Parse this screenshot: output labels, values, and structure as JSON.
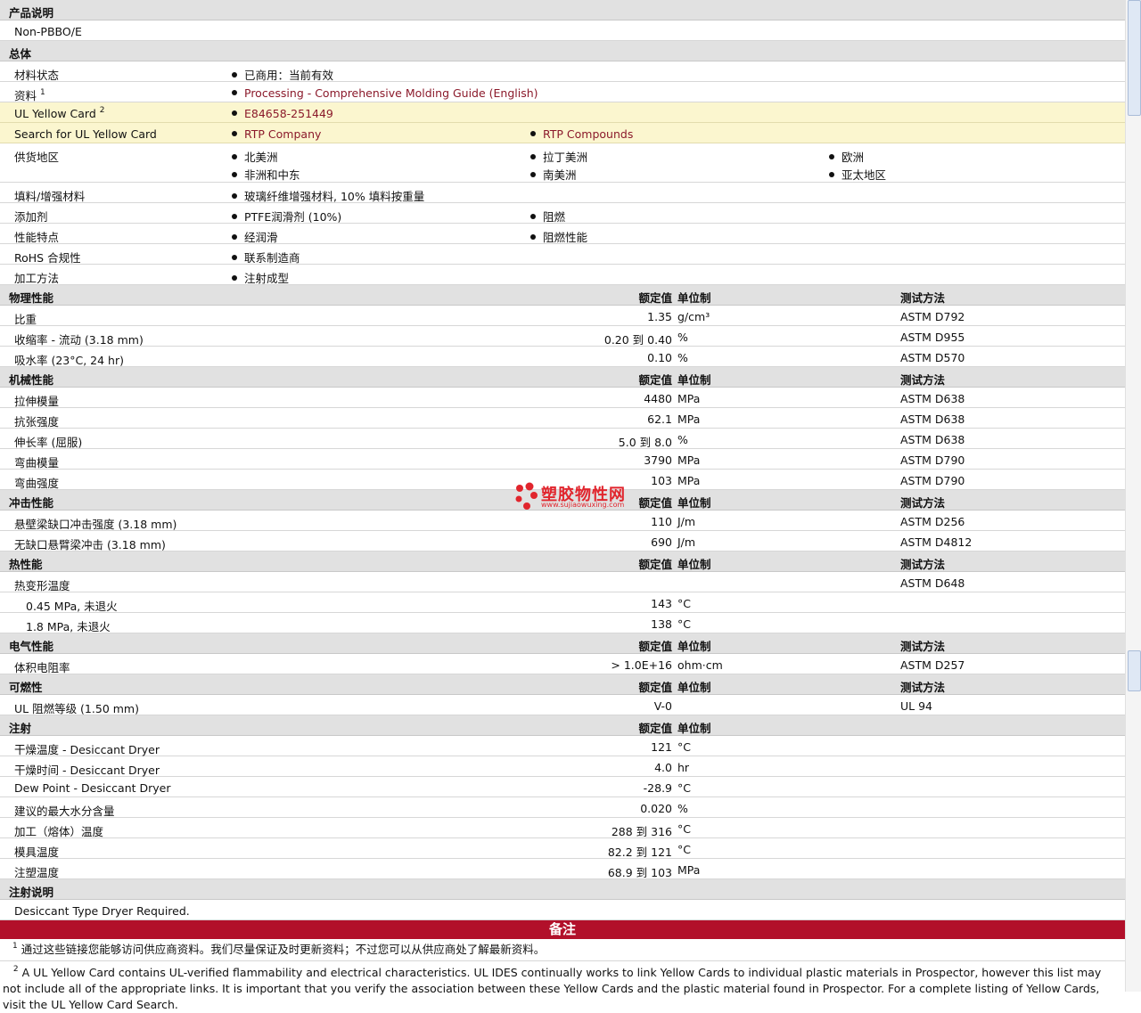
{
  "product_desc": {
    "title": "产品说明",
    "text": "Non-PBBO/E"
  },
  "general": {
    "title": "总体",
    "material_status": {
      "label": "材料状态",
      "value": "已商用：当前有效"
    },
    "literature": {
      "label": "资料",
      "sup": "1",
      "value": "Processing - Comprehensive Molding Guide (English)"
    },
    "ul_card": {
      "label": "UL Yellow Card",
      "sup": "2",
      "value": "E84658-251449"
    },
    "ul_search": {
      "label": "Search for UL Yellow Card",
      "values": [
        "RTP Company",
        "RTP Compounds"
      ]
    },
    "region": {
      "label": "供货地区",
      "values": [
        "北美洲",
        "拉丁美洲",
        "欧洲",
        "非洲和中东",
        "南美洲",
        "亚太地区"
      ]
    },
    "filler": {
      "label": "填料/增强材料",
      "value": "玻璃纤维增强材料, 10% 填料按重量"
    },
    "additive": {
      "label": "添加剂",
      "values": [
        "PTFE润滑剂 (10%)",
        "阻燃"
      ]
    },
    "features": {
      "label": "性能特点",
      "values": [
        "经润滑",
        "阻燃性能"
      ]
    },
    "rohs": {
      "label": "RoHS 合规性",
      "value": "联系制造商"
    },
    "processing": {
      "label": "加工方法",
      "value": "注射成型"
    }
  },
  "col_headers": {
    "value": "额定值",
    "unit": "单位制",
    "method": "测试方法"
  },
  "physical": {
    "title": "物理性能",
    "rows": [
      {
        "label": "比重",
        "value": "1.35",
        "unit": "g/cm³",
        "method": "ASTM D792"
      },
      {
        "label": "收缩率 - 流动 (3.18 mm)",
        "value": "0.20 到  0.40",
        "unit": "%",
        "method": "ASTM D955"
      },
      {
        "label": "吸水率 (23°C, 24 hr)",
        "value": "0.10",
        "unit": "%",
        "method": "ASTM D570"
      }
    ]
  },
  "mechanical": {
    "title": "机械性能",
    "rows": [
      {
        "label": "拉伸模量",
        "value": "4480",
        "unit": "MPa",
        "method": "ASTM D638"
      },
      {
        "label": "抗张强度",
        "value": "62.1",
        "unit": "MPa",
        "method": "ASTM D638"
      },
      {
        "label": "伸长率 (屈服)",
        "value": "5.0 到  8.0",
        "unit": "%",
        "method": "ASTM D638"
      },
      {
        "label": "弯曲模量",
        "value": "3790",
        "unit": "MPa",
        "method": "ASTM D790"
      },
      {
        "label": "弯曲强度",
        "value": "103",
        "unit": "MPa",
        "method": "ASTM D790"
      }
    ]
  },
  "impact": {
    "title": "冲击性能",
    "rows": [
      {
        "label": "悬壁梁缺口冲击强度 (3.18 mm)",
        "value": "110",
        "unit": "J/m",
        "method": "ASTM D256"
      },
      {
        "label": "无缺口悬臂梁冲击 (3.18 mm)",
        "value": "690",
        "unit": "J/m",
        "method": "ASTM D4812"
      }
    ]
  },
  "thermal": {
    "title": "热性能",
    "rows": [
      {
        "label": "热变形温度",
        "value": "",
        "unit": "",
        "method": "ASTM D648"
      },
      {
        "label": "0.45 MPa, 未退火",
        "value": "143",
        "unit": "°C",
        "method": ""
      },
      {
        "label": "1.8 MPa, 未退火",
        "value": "138",
        "unit": "°C",
        "method": ""
      }
    ]
  },
  "electrical": {
    "title": "电气性能",
    "rows": [
      {
        "label": "体积电阻率",
        "value": "> 1.0E+16",
        "unit": "ohm·cm",
        "method": "ASTM D257"
      }
    ]
  },
  "flammability": {
    "title": "可燃性",
    "rows": [
      {
        "label": "UL 阻燃等级 (1.50 mm)",
        "value": "V-0",
        "unit": "",
        "method": "UL 94"
      }
    ]
  },
  "injection": {
    "title": "注射",
    "rows": [
      {
        "label": "干燥温度 - Desiccant Dryer",
        "value": "121",
        "unit": "°C"
      },
      {
        "label": "干燥时间 - Desiccant Dryer",
        "value": "4.0",
        "unit": "hr"
      },
      {
        "label": "Dew Point - Desiccant Dryer",
        "value": "-28.9",
        "unit": "°C"
      },
      {
        "label": "建议的最大水分含量",
        "value": "0.020",
        "unit": "%"
      },
      {
        "label": "加工（熔体）温度",
        "value": "288 到  316",
        "unit": "°C"
      },
      {
        "label": "模具温度",
        "value": "82.2 到  121",
        "unit": "°C"
      },
      {
        "label": "注塑温度",
        "value": "68.9 到  103",
        "unit": "MPa"
      }
    ]
  },
  "injection_notes": {
    "title": "注射说明",
    "text": "Desiccant Type Dryer Required."
  },
  "notes": {
    "title": "备注",
    "n1_sup": "1",
    "n1": "通过这些链接您能够访问供应商资料。我们尽量保证及时更新资料；不过您可以从供应商处了解最新资料。",
    "n2_sup": "2",
    "n2": "A UL Yellow Card contains UL-verified flammability and electrical characteristics. UL IDES continually works to link Yellow Cards to individual plastic materials in Prospector, however this list may not include all of the appropriate links. It is important that you verify the association between these Yellow Cards and the plastic material found in Prospector. For a complete listing of Yellow Cards, visit the UL Yellow Card Search."
  },
  "watermark": {
    "title": "塑胶物性网",
    "url": "www.sujiaowuxing.com"
  },
  "colors": {
    "link": "#8b1a2b",
    "notes_bar": "#b2102a",
    "highlight_row": "#fbf6cf",
    "header_bg": "#e1e1e1"
  }
}
